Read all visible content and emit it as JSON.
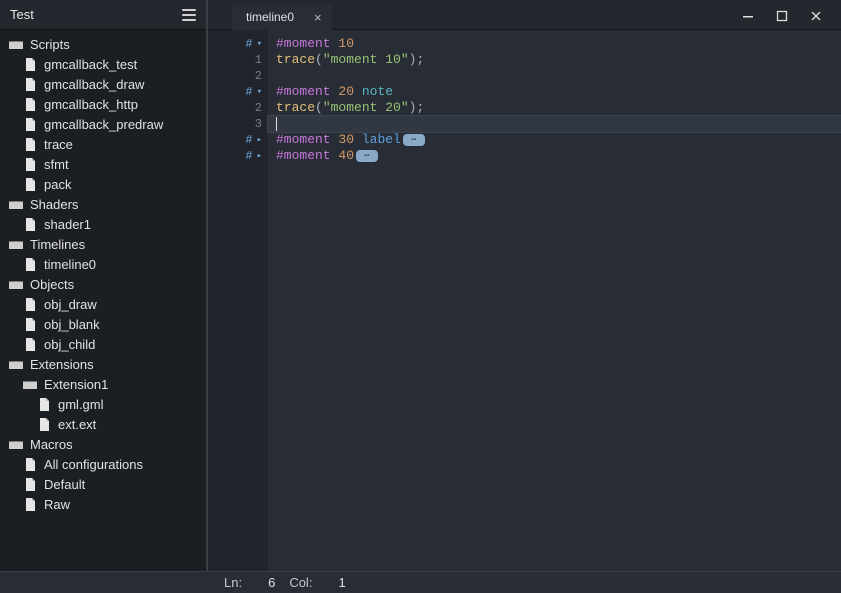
{
  "sidebar": {
    "title": "Test",
    "nodes": [
      {
        "type": "folder",
        "indent": 0,
        "label": "Scripts"
      },
      {
        "type": "file",
        "indent": 1,
        "label": "gmcallback_test"
      },
      {
        "type": "file",
        "indent": 1,
        "label": "gmcallback_draw"
      },
      {
        "type": "file",
        "indent": 1,
        "label": "gmcallback_http"
      },
      {
        "type": "file",
        "indent": 1,
        "label": "gmcallback_predraw"
      },
      {
        "type": "file",
        "indent": 1,
        "label": "trace"
      },
      {
        "type": "file",
        "indent": 1,
        "label": "sfmt"
      },
      {
        "type": "file",
        "indent": 1,
        "label": "pack"
      },
      {
        "type": "folder",
        "indent": 0,
        "label": "Shaders"
      },
      {
        "type": "file",
        "indent": 1,
        "label": "shader1"
      },
      {
        "type": "folder",
        "indent": 0,
        "label": "Timelines"
      },
      {
        "type": "file",
        "indent": 1,
        "label": "timeline0"
      },
      {
        "type": "folder",
        "indent": 0,
        "label": "Objects"
      },
      {
        "type": "file",
        "indent": 1,
        "label": "obj_draw"
      },
      {
        "type": "file",
        "indent": 1,
        "label": "obj_blank"
      },
      {
        "type": "file",
        "indent": 1,
        "label": "obj_child"
      },
      {
        "type": "folder",
        "indent": 0,
        "label": "Extensions"
      },
      {
        "type": "ext",
        "indent": 1,
        "label": "Extension1"
      },
      {
        "type": "file",
        "indent": 2,
        "label": "gml.gml"
      },
      {
        "type": "file",
        "indent": 2,
        "label": "ext.ext"
      },
      {
        "type": "folder",
        "indent": 0,
        "label": "Macros"
      },
      {
        "type": "file",
        "indent": 1,
        "label": "All configurations"
      },
      {
        "type": "file",
        "indent": 1,
        "label": "Default"
      },
      {
        "type": "file",
        "indent": 1,
        "label": "Raw"
      }
    ]
  },
  "tabs": [
    {
      "label": "timeline0"
    }
  ],
  "gutter": [
    {
      "text": "#",
      "section": true,
      "expanded": true
    },
    {
      "text": "1"
    },
    {
      "text": "2"
    },
    {
      "text": "#",
      "section": true,
      "expanded": true
    },
    {
      "text": "2"
    },
    {
      "text": "3",
      "current": true
    },
    {
      "text": "#",
      "section": true,
      "expanded": false
    },
    {
      "text": "#",
      "section": true,
      "expanded": false
    }
  ],
  "code": [
    {
      "tokens": [
        [
          "dir",
          "#moment"
        ],
        [
          "sp",
          " "
        ],
        [
          "num",
          "10"
        ]
      ]
    },
    {
      "tokens": [
        [
          "func",
          "trace"
        ],
        [
          "punc",
          "("
        ],
        [
          "str",
          "\"moment 10\""
        ],
        [
          "punc",
          ")"
        ],
        [
          "punc",
          ";"
        ]
      ]
    },
    {
      "tokens": []
    },
    {
      "tokens": [
        [
          "dir",
          "#moment"
        ],
        [
          "sp",
          " "
        ],
        [
          "num",
          "20"
        ],
        [
          "sp",
          " "
        ],
        [
          "note",
          "note"
        ]
      ]
    },
    {
      "tokens": [
        [
          "func",
          "trace"
        ],
        [
          "punc",
          "("
        ],
        [
          "str",
          "\"moment 20\""
        ],
        [
          "punc",
          ")"
        ],
        [
          "punc",
          ";"
        ]
      ]
    },
    {
      "tokens": [],
      "current": true
    },
    {
      "tokens": [
        [
          "dir",
          "#moment"
        ],
        [
          "sp",
          " "
        ],
        [
          "num",
          "30"
        ],
        [
          "sp",
          " "
        ],
        [
          "ident",
          "label"
        ]
      ],
      "folded": true
    },
    {
      "tokens": [
        [
          "dir",
          "#moment"
        ],
        [
          "sp",
          " "
        ],
        [
          "num",
          "40"
        ]
      ],
      "folded": true
    }
  ],
  "status": {
    "ln_label": "Ln:",
    "ln_value": "6",
    "col_label": "Col:",
    "col_value": "1"
  }
}
